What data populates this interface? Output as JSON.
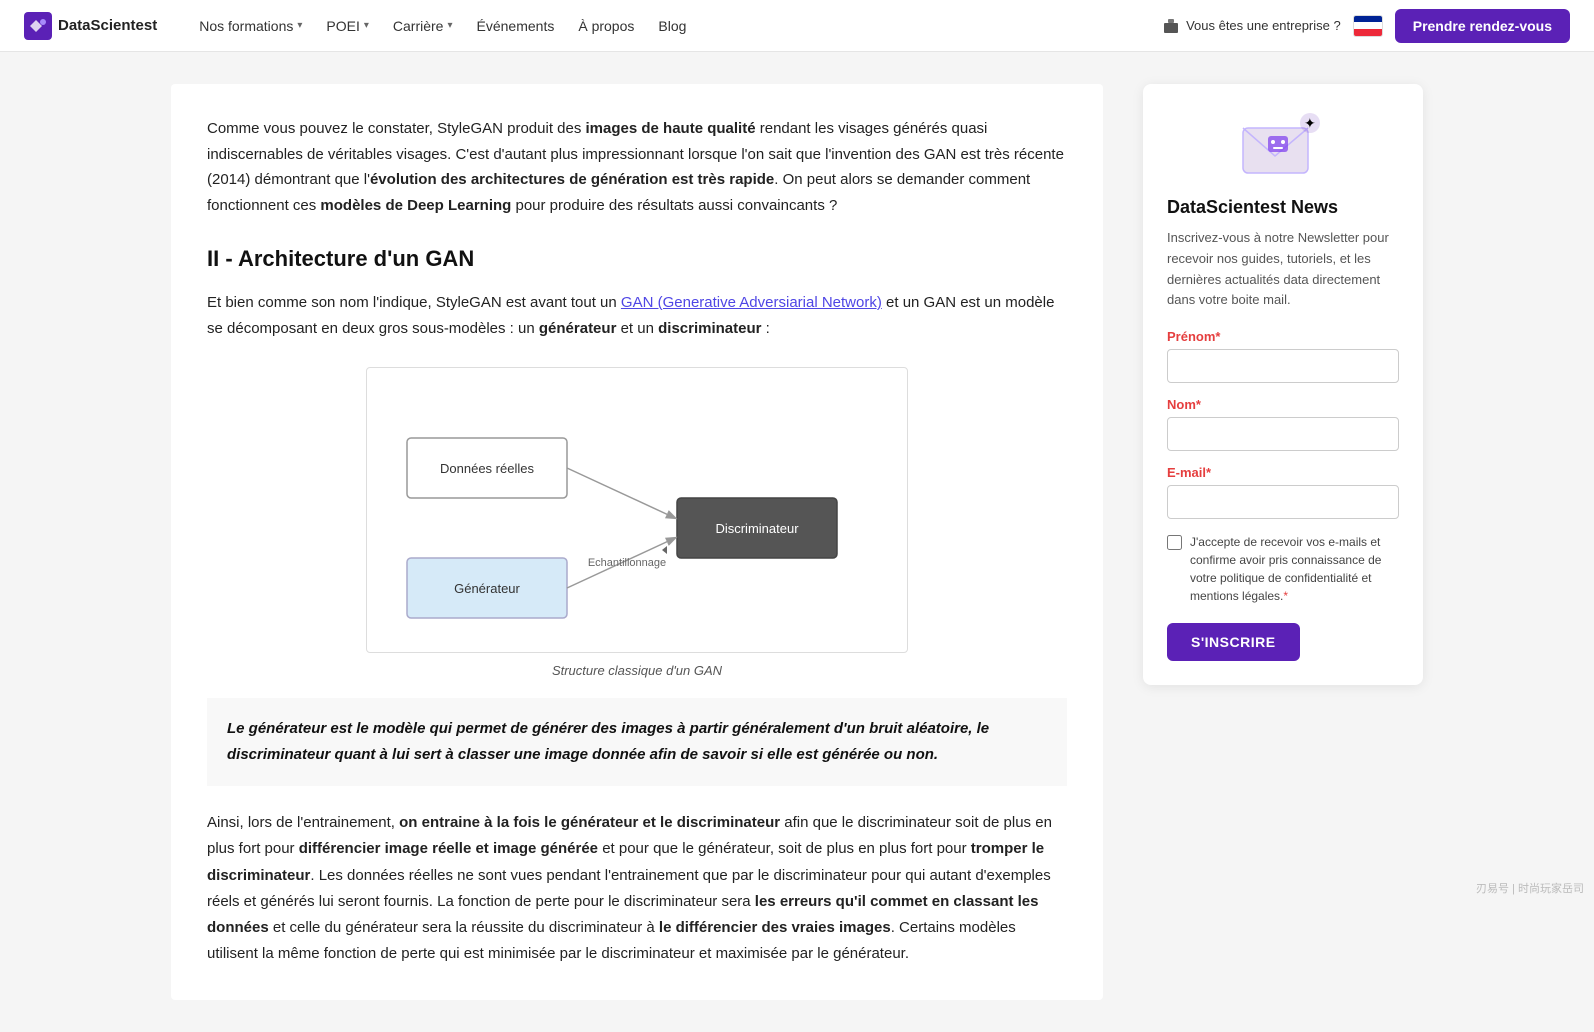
{
  "nav": {
    "logo_text": "DataScientest",
    "links": [
      {
        "label": "Nos formations",
        "has_dropdown": true
      },
      {
        "label": "POEI",
        "has_dropdown": true
      },
      {
        "label": "Carrière",
        "has_dropdown": true
      },
      {
        "label": "Événements",
        "has_dropdown": false
      },
      {
        "label": "À propos",
        "has_dropdown": false
      },
      {
        "label": "Blog",
        "has_dropdown": false
      }
    ],
    "enterprise_label": "Vous êtes une entreprise ?",
    "cta_label": "Prendre rendez-vous"
  },
  "article": {
    "intro_text_1": "Comme vous pouvez le constater, StyleGAN produit des ",
    "intro_bold_1": "images de haute qualité",
    "intro_text_2": " rendant les visages générés quasi indiscernables de véritables visages. C'est d'autant plus impressionnant lorsque l'on sait que l'invention des GAN est très récente (2014) démontrant que l'",
    "intro_bold_2": "évolution des architectures de génération est très rapide",
    "intro_text_3": ". On peut alors se demander comment fonctionnent ces ",
    "intro_bold_3": "modèles de Deep Learning",
    "intro_text_4": " pour produire des résultats aussi convaincants ?",
    "section_title": "II - Architecture d'un GAN",
    "para1_text1": "Et bien comme son nom l'indique, StyleGAN est avant tout un ",
    "para1_link": "GAN (Generative Adversiarial Network)",
    "para1_text2": " et un GAN est un modèle se décomposant en deux gros sous-modèles : un ",
    "para1_bold1": "générateur",
    "para1_text3": " et un ",
    "para1_bold2": "discriminateur",
    "para1_text4": " :",
    "diagram_caption": "Structure classique d'un GAN",
    "diagram": {
      "box_donnees": "Données réelles",
      "box_generateur": "Générateur",
      "box_discriminateur": "Discriminateur",
      "label_echantillonnage": "Echantillonnage"
    },
    "blockquote": "Le générateur est le modèle qui permet de générer des images à partir généralement d'un bruit aléatoire, le discriminateur quant à lui sert à classer une image donnée afin de savoir si elle est générée ou non.",
    "last_para_text1": "Ainsi, lors de l'entrainement, ",
    "last_para_bold1": "on entraine à la fois le générateur et le discriminateur",
    "last_para_text2": " afin que le discriminateur soit de plus en plus fort pour ",
    "last_para_bold2": "différencier image réelle et image générée",
    "last_para_text3": " et pour que le générateur, soit de plus en plus fort pour ",
    "last_para_bold3": "tromper le discriminateur",
    "last_para_text4": ". Les données réelles ne sont vues pendant l'entrainement que par le discriminateur pour qui autant d'exemples réels et générés lui seront fournis. La fonction de perte pour le discriminateur sera ",
    "last_para_bold4": "les erreurs qu'il commet en classant les données",
    "last_para_text5": " et celle du générateur sera la réussite du discriminateur à ",
    "last_para_bold5": "le différencier des vraies images",
    "last_para_text6": ". Certains modèles utilisent la même fonction de perte qui est minimisée par le discriminateur et maximisée par le générateur."
  },
  "sidebar": {
    "title": "DataScientest News",
    "description": "Inscrivez-vous à notre Newsletter pour recevoir nos guides, tutoriels, et les dernières actualités data directement dans votre boite mail.",
    "prenom_label": "Prénom",
    "nom_label": "Nom",
    "email_label": "E-mail",
    "required_mark": "*",
    "checkbox_label": "J'accepte de recevoir vos e-mails et confirme avoir pris connaissance de votre politique de confidentialité et mentions légales.",
    "checkbox_required": "*",
    "submit_label": "S'INSCRIRE"
  }
}
